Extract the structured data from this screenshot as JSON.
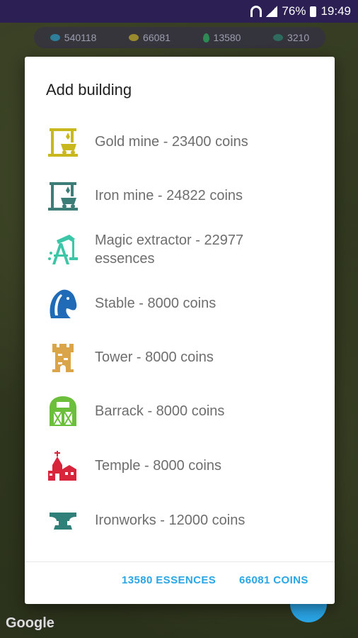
{
  "status_bar": {
    "battery_percent": "76%",
    "time": "19:49"
  },
  "resources": [
    {
      "value": "540118",
      "icon": "gem-icon",
      "color": "#3aa3d0"
    },
    {
      "value": "66081",
      "icon": "coins-icon",
      "color": "#c9b43a"
    },
    {
      "value": "13580",
      "icon": "essence-drop-icon",
      "color": "#3aa86a"
    },
    {
      "value": "3210",
      "icon": "iron-icon",
      "color": "#3a8a7a"
    }
  ],
  "dialog": {
    "title": "Add building",
    "items": [
      {
        "label": "Gold mine - 23400 coins",
        "icon": "gold-mine-icon",
        "color": "#c9b71e"
      },
      {
        "label": "Iron mine - 24822 coins",
        "icon": "iron-mine-icon",
        "color": "#3d7d77"
      },
      {
        "label": "Magic extractor - 22977 essences",
        "icon": "magic-extractor-icon",
        "color": "#3cc5a6"
      },
      {
        "label": "Stable - 8000 coins",
        "icon": "stable-horse-icon",
        "color": "#1f6bb8"
      },
      {
        "label": "Tower - 8000 coins",
        "icon": "tower-icon",
        "color": "#d9a548"
      },
      {
        "label": "Barrack - 8000 coins",
        "icon": "barrack-icon",
        "color": "#6cbf3a"
      },
      {
        "label": "Temple - 8000 coins",
        "icon": "temple-icon",
        "color": "#d8253c"
      },
      {
        "label": "Ironworks - 12000 coins",
        "icon": "anvil-icon",
        "color": "#2f8078"
      }
    ],
    "buttons": {
      "essences": "13580 ESSENCES",
      "coins": "66081 COINS"
    }
  },
  "map_attribution": "Google"
}
